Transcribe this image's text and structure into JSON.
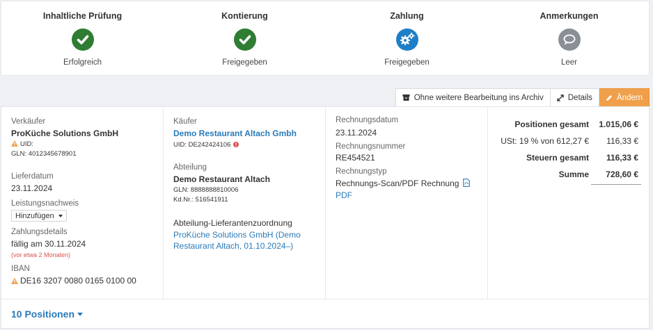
{
  "steps": [
    {
      "title": "Inhaltliche Prüfung",
      "status": "Erfolgreich",
      "icon": "check-icon",
      "color": "#2e7d32"
    },
    {
      "title": "Kontierung",
      "status": "Freigegeben",
      "icon": "check-icon",
      "color": "#2e7d32"
    },
    {
      "title": "Zahlung",
      "status": "Freigegeben",
      "icon": "gears-icon",
      "color": "#1e7fc7"
    },
    {
      "title": "Anmerkungen",
      "status": "Leer",
      "icon": "comment-icon",
      "color": "#8a8f96"
    }
  ],
  "toolbar": {
    "archive_label": "Ohne weitere Bearbeitung ins Archiv",
    "details_label": "Details",
    "edit_label": "Ändern",
    "edit_color": "#f0a04a"
  },
  "seller": {
    "label": "Verkäufer",
    "name": "ProKüche Solutions GmbH",
    "uid_label": "UID:",
    "gln": "GLN: 4012345678901",
    "delivery_label": "Lieferdatum",
    "delivery_date": "23.11.2024",
    "proof_label": "Leistungsnachweis",
    "proof_button": "Hinzufügen",
    "payment_label": "Zahlungsdetails",
    "payment_due": "fällig am 30.11.2024",
    "payment_relative": "(vor etwa 2 Monaten)",
    "iban_label": "IBAN",
    "iban": "DE16 3207 0080 0165 0100 00"
  },
  "buyer": {
    "label": "Käufer",
    "name": "Demo Restaurant Altach Gmbh",
    "uid": "UID: DE242424106",
    "department_label": "Abteilung",
    "department": "Demo Restaurant Altach",
    "gln": "GLN: 8888888810006",
    "customer_no": "Kd.Nr.: 516541911",
    "assignment_label": "Abteilung-Lieferantenzuordnung",
    "assignment_line1": "ProKüche Solutions GmbH (Demo",
    "assignment_line2": "Restaurant Altach, 01.10.2024–)"
  },
  "invoice": {
    "date_label": "Rechnungsdatum",
    "date": "23.11.2024",
    "number_label": "Rechnungsnummer",
    "number": "RE454521",
    "type_label": "Rechnungstyp",
    "type": "Rechnungs-Scan/PDF Rechnung",
    "pdf_link": "PDF"
  },
  "totals": {
    "positions_label": "Positionen gesamt",
    "positions_value": "1.015,06 €",
    "vat_label": "USt: 19 % von 612,27 €",
    "vat_value": "116,33 €",
    "tax_label": "Steuern gesamt",
    "tax_value": "116,33 €",
    "sum_label": "Summe",
    "sum_value": "728,60 €"
  },
  "positions_toggle": "10 Positionen"
}
